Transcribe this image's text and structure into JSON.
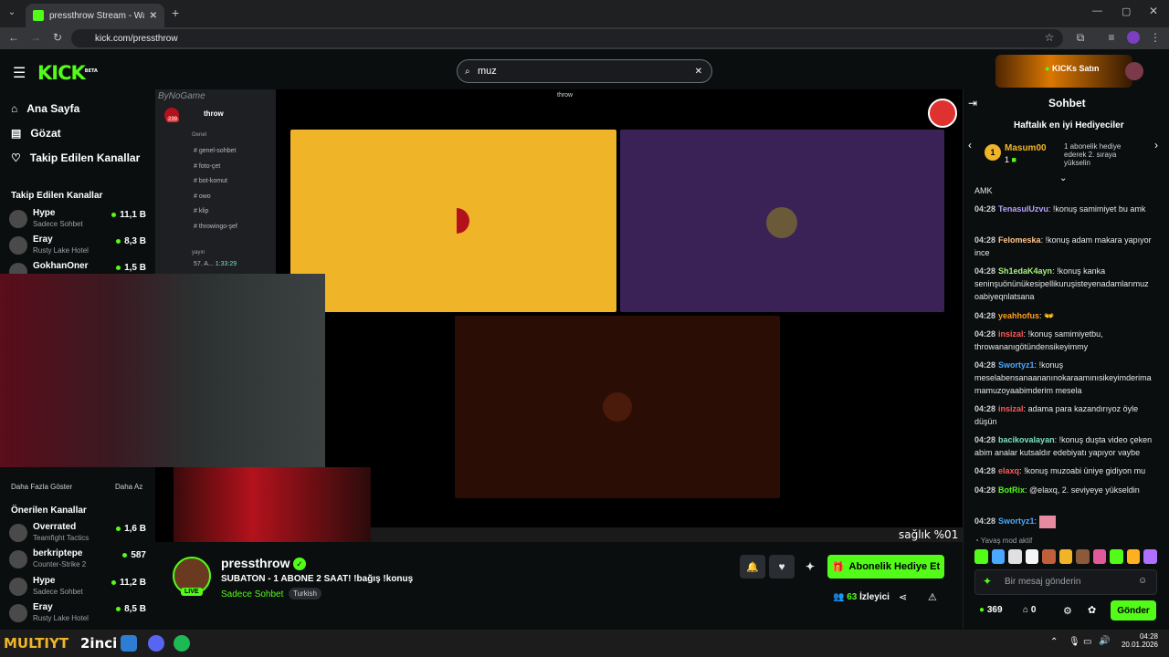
{
  "browser": {
    "tab_title": "pressthrow Stream - Watch Live",
    "url": "kick.com/pressthrow"
  },
  "kick": {
    "logo": "KICK",
    "beta": "BETA",
    "search_value": "muz",
    "kicks_label": "KICKs Satın"
  },
  "nav": {
    "home": "Ana Sayfa",
    "browse": "Gözat",
    "following": "Takip Edilen Kanallar"
  },
  "followed_heading": "Takip Edilen Kanallar",
  "followed": [
    {
      "name": "Hype",
      "game": "Sadece Sohbet",
      "viewers": "11,1 B"
    },
    {
      "name": "Eray",
      "game": "Rusty Lake Hotel",
      "viewers": "8,3 B"
    },
    {
      "name": "GokhanOner",
      "game": "",
      "viewers": "1,5 B"
    }
  ],
  "show_more": "Daha Fazla Göster",
  "show_less": "Daha Az",
  "recommended_heading": "Önerilen Kanallar",
  "recommended": [
    {
      "name": "Overrated",
      "game": "Teamfight Tactics",
      "viewers": "1,6 B"
    },
    {
      "name": "berkriptepe",
      "game": "Counter-Strike 2",
      "viewers": "587"
    },
    {
      "name": "Hype",
      "game": "Sadece Sohbet",
      "viewers": "11,2 B"
    },
    {
      "name": "Eray",
      "game": "Rusty Lake Hotel",
      "viewers": "8,5 B"
    }
  ],
  "discord": {
    "server": "throw",
    "watermark": "ByNoGame",
    "title": "throw",
    "section": "Genel",
    "channels": [
      "genel-sohbet",
      "foto-çet",
      "bot-komut",
      "owo",
      "klip",
      "throwingo-şef"
    ],
    "voice_section": "yayın",
    "voice_item": "57. A...",
    "voice_time": "1:33:29",
    "badge": "239"
  },
  "overlay": {
    "text": "sağlık %01",
    "bottom_brand": "MULTIYT"
  },
  "stream": {
    "channel": "pressthrow",
    "title": "SUBATON - 1 ABONE 2 SAAT! !bağış !konuş",
    "category": "Sadece Sohbet",
    "language": "Turkish",
    "live": "LIVE",
    "viewers": "63",
    "viewers_label": "İzleyici",
    "gift_sub": "Abonelik Hediye Et"
  },
  "chat": {
    "title": "Sohbet",
    "top_gifters": "Haftalık en iyi Hediyeciler",
    "gifter_name": "Masum00",
    "gifter_count": "1",
    "gifter_rank": "1",
    "gifter_hint": "1 abonelik hediye ederek 2. sıraya yükselin",
    "slow_mode": "Yavaş mod aktif",
    "placeholder": "Bir mesaj gönderin",
    "points": "369",
    "count": "0",
    "send": "Gönder",
    "messages": [
      {
        "time": "",
        "user": "",
        "text": "AMK",
        "color": "#e6e8ea"
      },
      {
        "time": "04:28",
        "user": "TenasulUzvu",
        "text": "!konuş samimiyet bu amk",
        "color": "#b8a2ff"
      },
      {
        "time": "04:28",
        "user": "Felomeska",
        "text": "!konuş adam makara yapıyor ince",
        "color": "#ffc48a"
      },
      {
        "time": "04:28",
        "user": "Sh1edaK4ayn",
        "text": "!konuş kanka seninşuönünükesipellikuruşisteyenadamlarımuz oabiyeqnlatsana",
        "color": "#a6f07a"
      },
      {
        "time": "04:28",
        "user": "yeahhofus",
        "text": "👐",
        "color": "#ff9f1c"
      },
      {
        "time": "04:28",
        "user": "insizal",
        "text": "!konuş samimiyetbu, throwananıgötündensikeyimmy",
        "color": "#ff5a5a"
      },
      {
        "time": "04:28",
        "user": "Swortyz1",
        "text": "!konuş meselabensanaananınokaraamınısikeyimderima mamuzoyaabimderim mesela",
        "color": "#4aa8ff"
      },
      {
        "time": "04:28",
        "user": "insizal",
        "text": "adama para kazandırıyoz öyle düşün",
        "color": "#ff5a5a"
      },
      {
        "time": "04:28",
        "user": "bacikovalayan",
        "text": "!konuş duşta video çeken abim analar kutsaldır edebiyatı yapıyor vaybe",
        "color": "#7ee0c0"
      },
      {
        "time": "04:28",
        "user": "elaxq",
        "text": "!konuş muzoabi üniye gidiyon mu",
        "color": "#ff5a5a"
      },
      {
        "time": "04:28",
        "user": "BotRix",
        "text": "@elaxq, 2. seviyeye yükseldin",
        "color": "#53fc18"
      },
      {
        "time": "04:28",
        "user": "Swortyz1",
        "text": "",
        "color": "#4aa8ff"
      }
    ]
  },
  "taskbar": {
    "time": "04:28",
    "date": "20.01.2026",
    "label": "2inci"
  }
}
